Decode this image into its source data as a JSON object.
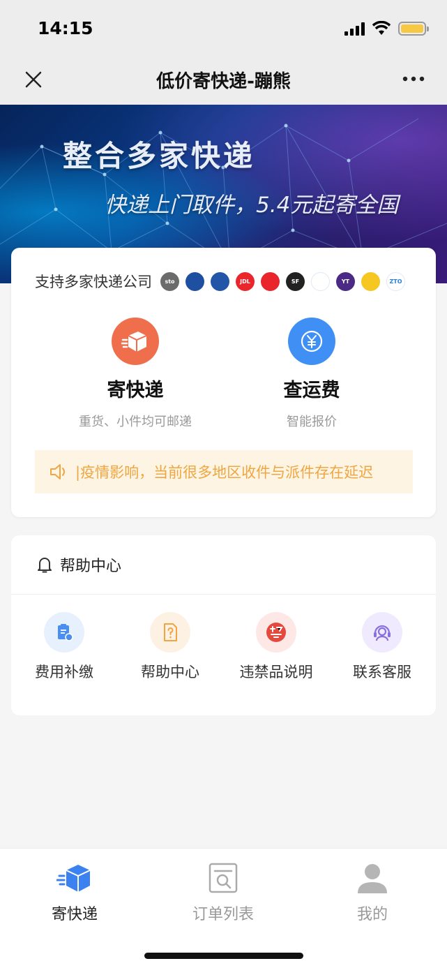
{
  "status_bar": {
    "time": "14:15",
    "battery_color": "#f7c844"
  },
  "nav": {
    "title": "低价寄快递-蹦熊",
    "close_icon": "close-icon",
    "more_icon": "more-icon"
  },
  "banner": {
    "title": "整合多家快递",
    "subtitle": "快递上门取件，5.4元起寄全国"
  },
  "support": {
    "label": "支持多家快递公司",
    "logos": [
      {
        "name": "sto-logo",
        "text": "sto",
        "color": "#6b6b6b"
      },
      {
        "name": "debang-logo",
        "text": "",
        "color": "#1f4fa0"
      },
      {
        "name": "jitu-logo",
        "text": "",
        "color": "#2356a6"
      },
      {
        "name": "jdl-logo",
        "text": "JDL",
        "color": "#e8262c"
      },
      {
        "name": "youzheng-logo",
        "text": "",
        "color": "#e8262c"
      },
      {
        "name": "sf-logo",
        "text": "SF",
        "color": "#222222"
      },
      {
        "name": "ems-logo",
        "text": "",
        "color": "#ffffff"
      },
      {
        "name": "yto-logo",
        "text": "YT",
        "color": "#4b2a86"
      },
      {
        "name": "yunda-logo",
        "text": "",
        "color": "#f6c720"
      },
      {
        "name": "zto-logo",
        "text": "ZTO",
        "color": "#ffffff"
      }
    ]
  },
  "services": {
    "send": {
      "title": "寄快递",
      "subtitle": "重货、小件均可邮递",
      "icon_color": "#ef6f4c"
    },
    "price": {
      "title": "查运费",
      "subtitle": "智能报价",
      "icon_color": "#3f8ff5"
    }
  },
  "notice": {
    "text": "|疫情影响，当前很多地区收件与派件存在延迟"
  },
  "help": {
    "title": "帮助中心",
    "items": [
      {
        "label": "费用补缴",
        "bg": "#e7f0fd",
        "color": "#4a8ff0"
      },
      {
        "label": "帮助中心",
        "bg": "#fdf1e3",
        "color": "#f0a640"
      },
      {
        "label": "违禁品说明",
        "bg": "#fde8e6",
        "color": "#e4493e"
      },
      {
        "label": "联系客服",
        "bg": "#efeafd",
        "color": "#8a6fe0"
      }
    ]
  },
  "tabs": [
    {
      "label": "寄快递",
      "active": true
    },
    {
      "label": "订单列表",
      "active": false
    },
    {
      "label": "我的",
      "active": false
    }
  ]
}
